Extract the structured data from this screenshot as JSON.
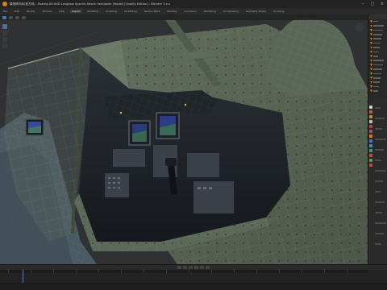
{
  "window": {
    "title": "模型精华库(官方网) - Boeing AH-64D Longbow Apache Attack Helicopter (Model) [Quality Edition] - Blender 3.x.x"
  },
  "menubar": {
    "items": [
      "File",
      "Edit",
      "Render",
      "Window",
      "Help",
      "Layout",
      "Modeling",
      "Sculpting",
      "UV Editing",
      "Texture Paint",
      "Shading",
      "Animation",
      "Rendering",
      "Compositing",
      "Geometry Nodes",
      "Scripting"
    ],
    "active_index": 5
  },
  "viewport": {
    "shading": "solid-wireframe",
    "icons": {
      "move_tool": "move-tool-icon",
      "rotate_tool": "rotate-tool-icon",
      "scale_tool": "scale-tool-icon",
      "navigation_gizmo": "navigation-gizmo-icon"
    }
  },
  "colors": {
    "accent": "#e87d0d",
    "selection": "#3c78c0",
    "background": "#1d1d1d"
  },
  "timeline": {
    "playhead_frame": 1
  }
}
